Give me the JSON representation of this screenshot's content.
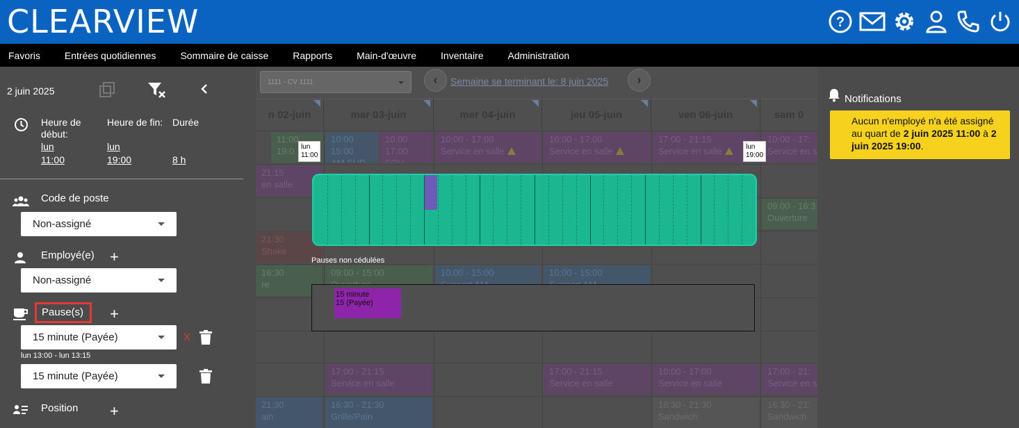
{
  "header": {
    "logo": "CLEARVIEW",
    "icons": [
      "help-icon",
      "mail-icon",
      "gear-icon",
      "user-icon",
      "phone-icon",
      "power-icon"
    ]
  },
  "nav": [
    "Favoris",
    "Entrées quotidiennes",
    "Sommaire de caisse",
    "Rapports",
    "Main-d'œuvre",
    "Inventaire",
    "Administration"
  ],
  "left": {
    "date": "2 juin 2025",
    "start_label": "Heure de début:",
    "end_label": "Heure de fin:",
    "duration_label": "Durée",
    "start_day": "lun",
    "start_time": "11:00",
    "end_day": "lun",
    "end_time": "19:00",
    "duration": "8 h",
    "job_code_label": "Code de poste",
    "job_code_value": "Non-assigné",
    "employee_label": "Employé(e)",
    "employee_value": "Non-assigné",
    "breaks_label": "Pause(s)",
    "break1_value": "15 minute (Payée)",
    "break1_x": "X",
    "break1_time": "lun 13:00 - lun 13:15",
    "break2_value": "15 minute (Payée)",
    "position_label": "Position",
    "plus": "+"
  },
  "calendar": {
    "week_select": "1111 - CV 1111",
    "week_link": "Semaine se terminant le: 8 juin 2025",
    "days": [
      "n 02-juin",
      "mar 03-juin",
      "mer 04-juin",
      "jeu 05-juin",
      "ven 06-juin",
      "sam 0"
    ],
    "shifts": [
      {
        "t1": "11:00",
        "t2": "19:0",
        "t3": "S.O.S."
      },
      {
        "t1": "10:00",
        "t2": "15:00",
        "t3": "AM SUP"
      },
      {
        "t1": "10:00",
        "t2": "17:00",
        "t3": "FOH"
      },
      {
        "t1": "10:00 - 17:00",
        "t2": "Service en salle"
      },
      {
        "t1": "10:00 - 17:00",
        "t2": "Service en salle"
      },
      {
        "t1": "17:00 - 21:15",
        "t2": "Service en salle"
      },
      {
        "t1": "10:00 - 17:",
        "t2": "Service en s"
      },
      {
        "t1": "21:15",
        "t2": "en salle"
      },
      {
        "t1": "09:00 - 16:3",
        "t2": "Ouverture"
      },
      {
        "t1": "21:30",
        "t2": "Shake"
      },
      {
        "t1": "16:30",
        "t2": "re"
      },
      {
        "t1": "09:00 - 15:00",
        "t2": "Ouverture"
      },
      {
        "t1": "10:00 - 15:00",
        "t2": "Support AM"
      },
      {
        "t1": "10:00 - 15:00",
        "t2": "Support AM"
      },
      {
        "t1": "17:00 - 21:15",
        "t2": "Service en salle"
      },
      {
        "t1": "17:00 - 21:15",
        "t2": "Service en salle"
      },
      {
        "t1": "10:00 - 17:00",
        "t2": "Service en salle"
      },
      {
        "t1": "17:00 - 21:",
        "t2": "Service en s"
      },
      {
        "t1": "21:30",
        "t2": "ain"
      },
      {
        "t1": "16:30 - 21:30",
        "t2": "Grille/Pain"
      },
      {
        "t1": "16:30 - 21:30",
        "t2": "Sandwich"
      },
      {
        "t1": "16:30 - 21:",
        "t2": "Sandwich"
      }
    ],
    "bubble_start_day": "lun",
    "bubble_start_time": "11:00",
    "bubble_end_day": "lun",
    "bubble_end_time": "19:00",
    "unscheduled_label": "Pauses non cédulées",
    "unscheduled_item_l1": "15 minute",
    "unscheduled_item_l2": "15 (Payée)"
  },
  "notifications": {
    "title": "Notifications",
    "msg_pre": "Aucun n'employé n'a été assigné au quart de ",
    "msg_b1": "2 juin 2025 11:00",
    "msg_mid": " à ",
    "msg_b2": "2 juin 2025 19:00",
    "msg_end": "."
  },
  "colors": {
    "header": "#0a62c1",
    "teal": "#1bb791",
    "break": "#6c5bb7",
    "notif": "#f6d21e",
    "highlight": "#e53935"
  }
}
